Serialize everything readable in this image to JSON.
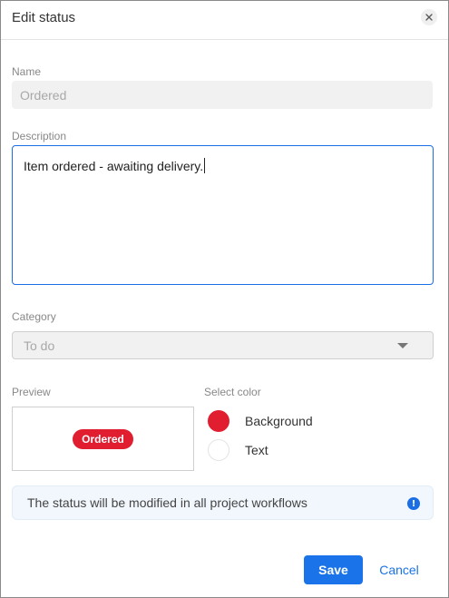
{
  "dialog": {
    "title": "Edit status",
    "close_icon": "close-icon"
  },
  "form": {
    "name_label": "Name",
    "name_value": "Ordered",
    "description_label": "Description",
    "description_value": "Item ordered - awaiting delivery.",
    "category_label": "Category",
    "category_value": "To do",
    "preview_label": "Preview",
    "select_color_label": "Select color"
  },
  "preview": {
    "badge_text": "Ordered",
    "badge_background": "#e01e2f",
    "badge_text_color": "#ffffff"
  },
  "colors": {
    "background_label": "Background",
    "background_color": "#e01e2f",
    "text_label": "Text",
    "text_color": "#ffffff"
  },
  "info": {
    "message": "The status will be modified in all project workflows",
    "icon": "info-icon"
  },
  "footer": {
    "save_label": "Save",
    "cancel_label": "Cancel",
    "accent_color": "#1a73e8"
  }
}
